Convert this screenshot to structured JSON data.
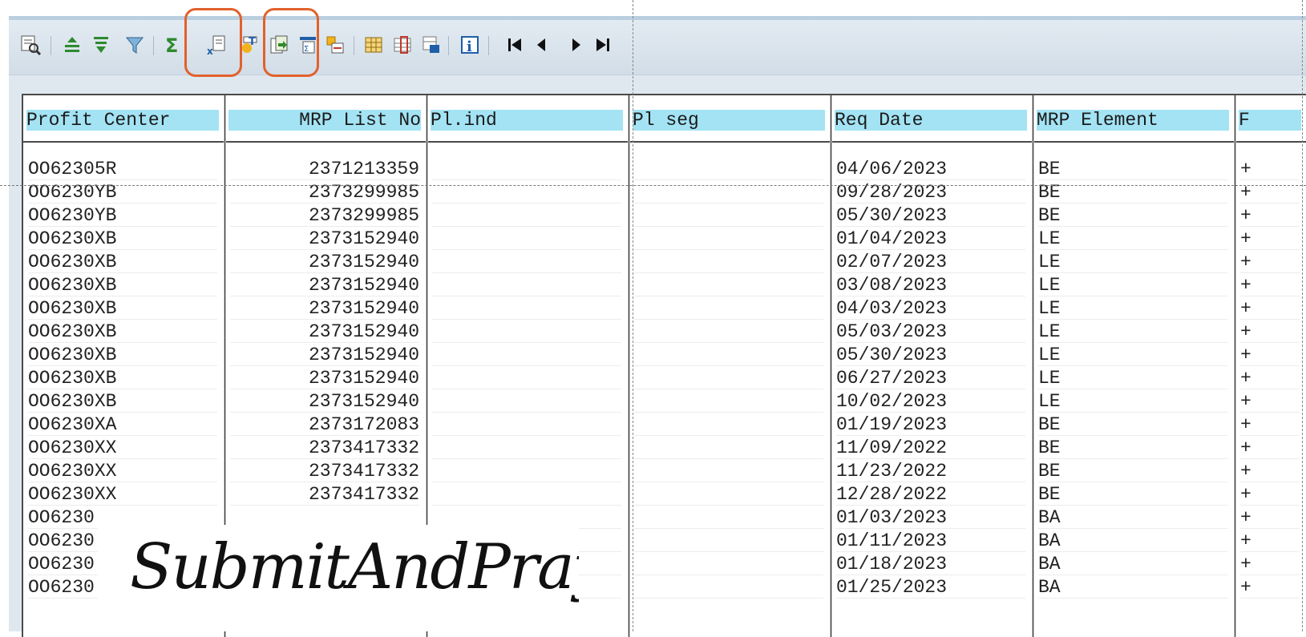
{
  "toolbar": {
    "icons": [
      "details-icon",
      "sort-ascending-icon",
      "sort-descending-icon",
      "filter-icon",
      "sum-icon",
      "subtotal-icon",
      "print-icon",
      "export-icon",
      "layout-icon",
      "find-icon",
      "grid-icon",
      "select-layout-icon",
      "change-layout-icon",
      "info-icon",
      "first-page-icon",
      "previous-page-icon",
      "next-page-icon",
      "last-page-icon"
    ]
  },
  "table": {
    "headers": [
      "Profit Center",
      "MRP List No",
      "Pl.ind",
      "Pl seg",
      "Req Date",
      "MRP Element",
      "F"
    ],
    "rows": [
      [
        "OO62305R",
        "2371213359",
        "",
        "",
        "04/06/2023",
        "BE",
        "+"
      ],
      [
        "OO6230YB",
        "2373299985",
        "",
        "",
        "09/28/2023",
        "BE",
        "+"
      ],
      [
        "OO6230YB",
        "2373299985",
        "",
        "",
        "05/30/2023",
        "BE",
        "+"
      ],
      [
        "OO6230XB",
        "2373152940",
        "",
        "",
        "01/04/2023",
        "LE",
        "+"
      ],
      [
        "OO6230XB",
        "2373152940",
        "",
        "",
        "02/07/2023",
        "LE",
        "+"
      ],
      [
        "OO6230XB",
        "2373152940",
        "",
        "",
        "03/08/2023",
        "LE",
        "+"
      ],
      [
        "OO6230XB",
        "2373152940",
        "",
        "",
        "04/03/2023",
        "LE",
        "+"
      ],
      [
        "OO6230XB",
        "2373152940",
        "",
        "",
        "05/03/2023",
        "LE",
        "+"
      ],
      [
        "OO6230XB",
        "2373152940",
        "",
        "",
        "05/30/2023",
        "LE",
        "+"
      ],
      [
        "OO6230XB",
        "2373152940",
        "",
        "",
        "06/27/2023",
        "LE",
        "+"
      ],
      [
        "OO6230XB",
        "2373152940",
        "",
        "",
        "10/02/2023",
        "LE",
        "+"
      ],
      [
        "OO6230XA",
        "2373172083",
        "",
        "",
        "01/19/2023",
        "BE",
        "+"
      ],
      [
        "OO6230XX",
        "2373417332",
        "",
        "",
        "11/09/2022",
        "BE",
        "+"
      ],
      [
        "OO6230XX",
        "2373417332",
        "",
        "",
        "11/23/2022",
        "BE",
        "+"
      ],
      [
        "OO6230XX",
        "2373417332",
        "",
        "",
        "12/28/2022",
        "BE",
        "+"
      ],
      [
        "OO6230",
        "",
        "",
        "",
        "01/03/2023",
        "BA",
        "+"
      ],
      [
        "OO6230",
        "",
        "",
        "",
        "01/11/2023",
        "BA",
        "+"
      ],
      [
        "OO6230",
        "",
        "",
        "",
        "01/18/2023",
        "BA",
        "+"
      ],
      [
        "OO6230",
        "",
        "",
        "",
        "01/25/2023",
        "BA",
        "+"
      ]
    ]
  },
  "watermark": {
    "text": "SubmitAndPray.com"
  },
  "colors": {
    "header_bg": "#a3e3f4",
    "highlight": "#e2612c",
    "toolbar_bg": "#dfe8ef"
  }
}
